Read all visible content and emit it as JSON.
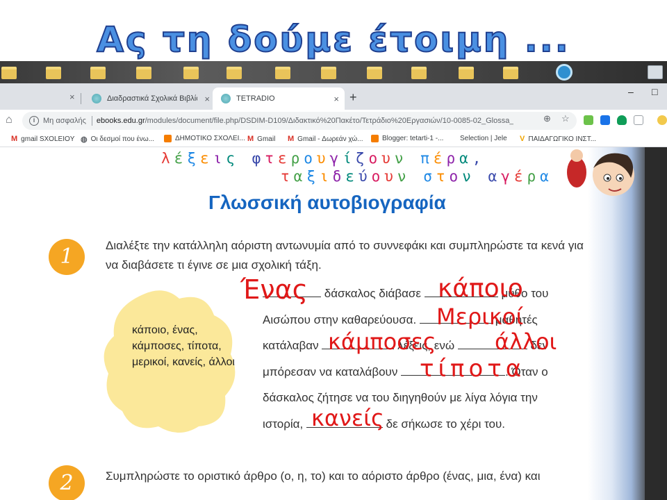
{
  "slide": {
    "title": "Ας τη δούμε έτοιμη ..."
  },
  "browser": {
    "tabs": [
      {
        "label": "Διαδραστικά Σχολικά Βιβλία | Π",
        "active": false
      },
      {
        "label": "TETRADIO",
        "active": true
      }
    ],
    "new_tab": "+",
    "tab_close": "×",
    "window_controls": {
      "minimize": "–",
      "maximize": "□"
    },
    "address": {
      "security": "Μη ασφαλής",
      "host": "ebooks.edu.gr",
      "path": "/modules/document/file.php/DSDIM-D109/Διδακτικό%20Πακέτο/Τετράδιο%20Εργασιών/10-0085-02_Glossa_D-..."
    },
    "bookmarks": [
      {
        "label": "gmail SXOLEIOY",
        "icon": "gmail-icon"
      },
      {
        "label": "Οι δεσμοί που ένω...",
        "icon": "globe-icon"
      },
      {
        "label": "ΔΗΜΟΤΙΚΟ ΣΧΟΛΕΙ...",
        "icon": "blogger-icon"
      },
      {
        "label": "Gmail",
        "icon": "gmail-icon"
      },
      {
        "label": "Gmail - Δωρεάν χώ...",
        "icon": "gmail-icon"
      },
      {
        "label": "Blogger: tetarti-1 -...",
        "icon": "blogger-icon"
      },
      {
        "label": "Selection | Jele",
        "icon": "page-icon"
      },
      {
        "label": "ΠΑΙΔΑΓΩΓΙΚΟ ΙΝΣΤ...",
        "icon": "v-icon"
      }
    ]
  },
  "page": {
    "banner": {
      "line1": "λέξεις φτερουγίζουν πέρα,",
      "line2": "ταξιδεύουν στον αγέρα",
      "colors": [
        "#e53935",
        "#43a047",
        "#1e88e5",
        "#fb8c00",
        "#8e24aa",
        "#00897b",
        "#3949ab",
        "#d81b60"
      ]
    },
    "heading": "Γλωσσική αυτοβιογραφία",
    "exercise1": {
      "number": "1",
      "instruction": "Διαλέξτε την κατάλληλη αόριστη αντωνυμία από το συννεφάκι και συμπληρώστε τα κενά για να διαβάσετε τι έγινε σε μια σχολική τάξη.",
      "cloud_words": "κάποιο, ένας, κάμποσες, τίποτα, μερικοί, κανείς, άλλοι",
      "lines": [
        "δάσκαλος διάβασε",
        "μύθο του",
        "Αισώπου στην καθαρεύουσα.",
        "μαθητές",
        "κατάλαβαν",
        "λέξεις, ενώ",
        "δεν",
        "μπόρεσαν να καταλάβουν",
        ". Όταν ο",
        "δάσκαλος ζήτησε να του διηγηθούν με λίγα λόγια την",
        "ιστορία,",
        "δε σήκωσε το χέρι του."
      ],
      "handwritten": [
        "Ένας",
        "κάποιο",
        "Μερικοί",
        "κάμποσες",
        "άλλοι",
        "τίποτα",
        "κανείς"
      ]
    },
    "exercise2": {
      "number": "2",
      "partial_line": "Συμπληρώστε το οριστικό άρθρο (ο, η, το) και το αόριστο άρθρο (ένας, μια, ένα) και"
    }
  },
  "colors": {
    "accent": "#1565c0",
    "badge": "#f5a623",
    "handwriting": "#e01818",
    "cloud": "#fbe89a"
  }
}
